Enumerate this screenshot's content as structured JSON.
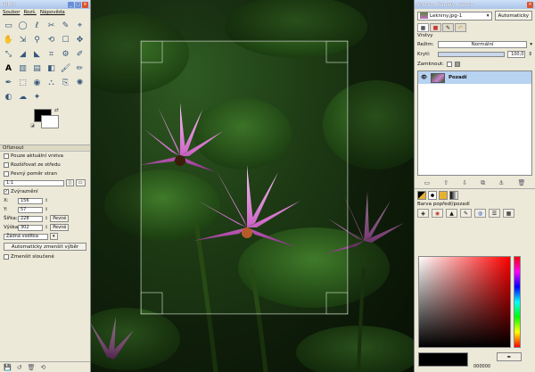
{
  "toolbox": {
    "title": "GIMP",
    "menu": [
      "Soubor",
      "Rozš.",
      "Nápověda"
    ],
    "tools": [
      "▭",
      "◯",
      "ℓ",
      "✂",
      "✎",
      "⌖",
      "✋",
      "⇲",
      "⚲",
      "⟲",
      "☐",
      "✥",
      "⤡",
      "◢",
      "◣",
      "⌗",
      "⚙",
      "✐",
      "A",
      "▥",
      "▤",
      "◧",
      "🖌",
      "✏",
      "✒",
      "⬚",
      "◉",
      "⛬",
      "⎘",
      "✺",
      "◐",
      "☁",
      "✦"
    ],
    "options": {
      "title": "Ořiznout",
      "current_layer": "Pouze aktuální vrstva",
      "expand_center": "Rozšiřovat ze středu",
      "fixed_ratio": "Pevný poměr stran",
      "ratio_value": "1:1",
      "highlight": "Zvýraznění",
      "x_label": "X:",
      "x_value": "156",
      "y_label": "Y:",
      "y_value": "57",
      "width_label": "Šířka:",
      "width_value": "228",
      "height_label": "Výška:",
      "height_value": "302",
      "fixed_label": "Pevné",
      "guides": "Žádná vodítka",
      "auto_shrink": "Automaticky zmenšit výběr",
      "shrink_merged": "Zmenšit sloučené"
    }
  },
  "dock": {
    "title": "Vrstvy, Kanály, Cesty",
    "image_name": "Lekniny.jpg-1",
    "auto_button": "Automaticky",
    "layers_label": "Vrstvy",
    "mode_label": "Režim:",
    "mode_value": "Normální",
    "opacity_label": "Krytí:",
    "opacity_value": "100,0",
    "opacity": 100,
    "lock_label": "Zamknout:",
    "layer_name": "Pozadí",
    "fgbg_label": "Barva popředí/pozadí",
    "hex_value": "000000"
  },
  "colors": {
    "accent": "#b8d2f2",
    "panel": "#ece9d8",
    "fg": "#000000",
    "bg": "#ffffff"
  }
}
